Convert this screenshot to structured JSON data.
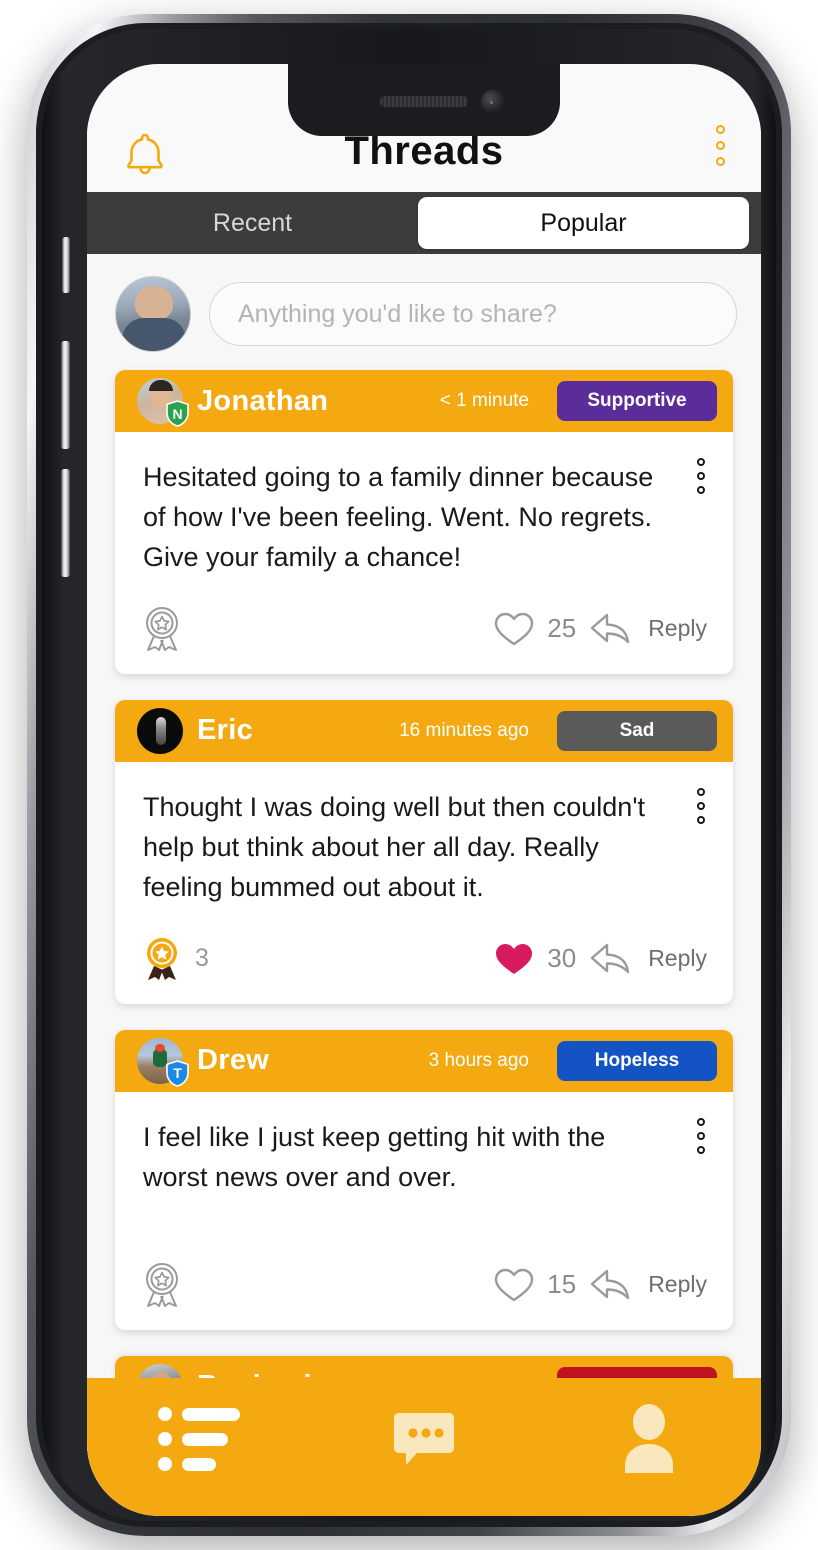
{
  "header": {
    "title": "Threads",
    "bell_icon": "bell-icon",
    "menu_icon": "kebab-menu-icon"
  },
  "tabs": [
    {
      "label": "Recent",
      "active": false
    },
    {
      "label": "Popular",
      "active": true
    }
  ],
  "composer": {
    "placeholder": "Anything you'd like to share?",
    "avatar": "user-avatar"
  },
  "colors": {
    "orange": "#F5A910",
    "supportive": "#5A2D9B",
    "sad": "#5A5A5A",
    "hopeless": "#1453C4",
    "angry": "#C1121F",
    "heart_filled": "#D81B60",
    "tab_bar": "#3C3C3C"
  },
  "posts": [
    {
      "name": "Jonathan",
      "time": "< 1 minute",
      "mood": "Supportive",
      "mood_color": "#5A2D9B",
      "badge_letter": "N",
      "badge_color": "#2BA24C",
      "text": "Hesitated going to a family dinner because of how I've been feeling. Went. No regrets. Give your family a chance!",
      "award_count": "",
      "award_filled": false,
      "likes": "25",
      "liked": false,
      "reply_label": "Reply"
    },
    {
      "name": "Eric",
      "time": "16 minutes ago",
      "mood": "Sad",
      "mood_color": "#5A5A5A",
      "badge_letter": "",
      "badge_color": "",
      "text": "Thought I was doing well but then couldn't help but think about her all day. Really feeling bummed out about it.",
      "award_count": "3",
      "award_filled": true,
      "likes": "30",
      "liked": true,
      "reply_label": "Reply"
    },
    {
      "name": "Drew",
      "time": "3 hours ago",
      "mood": "Hopeless",
      "mood_color": "#1453C4",
      "badge_letter": "T",
      "badge_color": "#1E88E5",
      "text": "I feel like I just keep getting hit with the worst news over and over.",
      "award_count": "",
      "award_filled": false,
      "likes": "15",
      "liked": false,
      "reply_label": "Reply"
    }
  ],
  "partial_post": {
    "name": "Benjamin",
    "time": "",
    "mood": "",
    "mood_color": "#C1121F"
  },
  "bottom_nav": [
    {
      "icon": "list-icon",
      "label": "threads",
      "active": true
    },
    {
      "icon": "chat-bubble-icon",
      "label": "messages",
      "active": false
    },
    {
      "icon": "person-icon",
      "label": "profile",
      "active": false
    }
  ]
}
